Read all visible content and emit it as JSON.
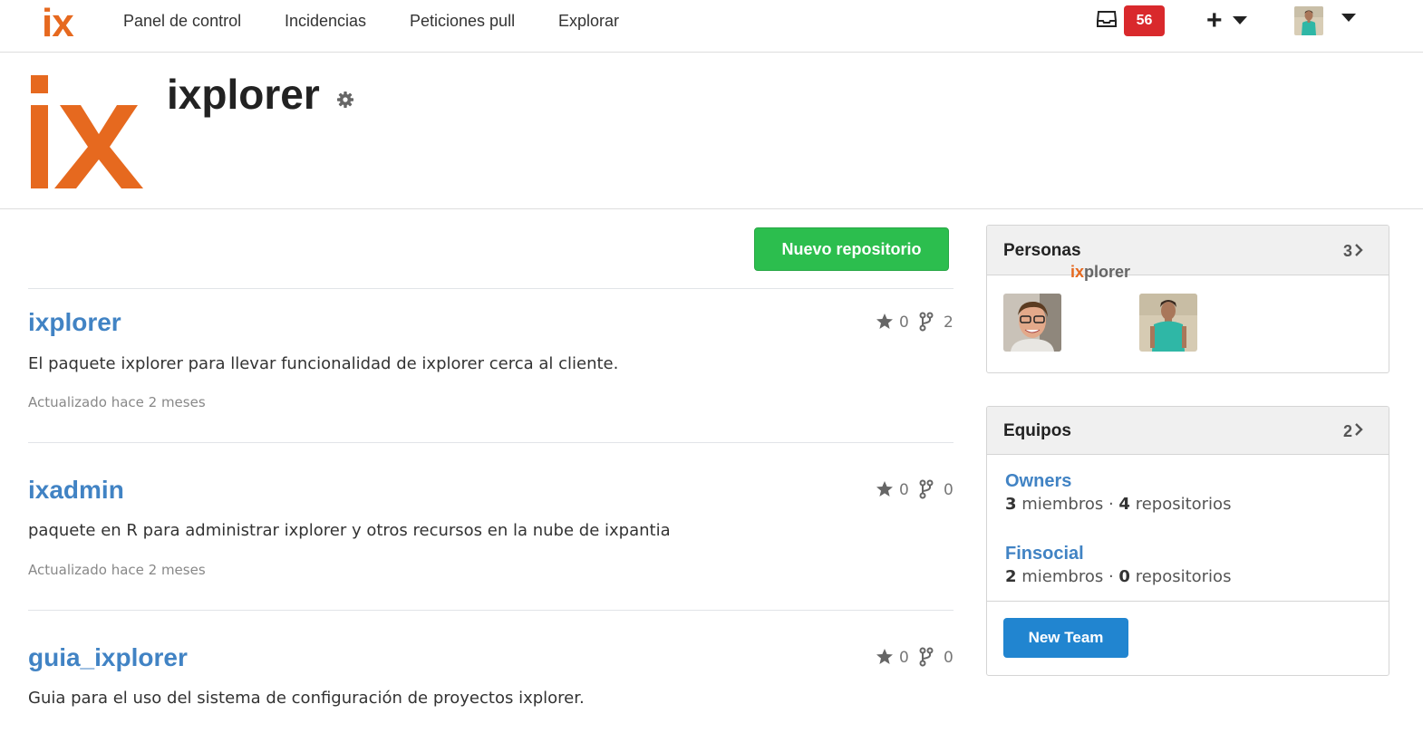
{
  "nav": {
    "logo": "ix",
    "items": [
      "Panel de control",
      "Incidencias",
      "Peticiones pull",
      "Explorar"
    ],
    "notification_count": "56",
    "icons": [
      "inbox-icon",
      "plus-icon",
      "caret-down-icon",
      "avatar"
    ]
  },
  "org": {
    "logo_text": "ix",
    "name": "ixplorer",
    "brand_color": "#e6691f"
  },
  "repos_section": {
    "new_repo_label": "Nuevo repositorio",
    "repos": [
      {
        "name": "ixplorer",
        "description": "El paquete ixplorer para llevar funcionalidad de ixplorer cerca al cliente.",
        "updated": "Actualizado hace 2 meses",
        "stars": "0",
        "forks": "2"
      },
      {
        "name": "ixadmin",
        "description": "paquete en R para administrar ixplorer y otros recursos en la nube de ixpantia",
        "updated": "Actualizado hace 2 meses",
        "stars": "0",
        "forks": "0"
      },
      {
        "name": "guia_ixplorer",
        "description": "Guia para el uso del sistema de configuración de proyectos ixplorer.",
        "updated": "",
        "stars": "0",
        "forks": "0"
      }
    ]
  },
  "people": {
    "title": "Personas",
    "count": "3",
    "org_member_prefix": "ix",
    "org_member_suffix": "plorer"
  },
  "teams": {
    "title": "Equipos",
    "count": "2",
    "list": [
      {
        "name": "Owners",
        "members": "3",
        "members_label": "miembros",
        "repos": "4",
        "repos_label": "repositorios"
      },
      {
        "name": "Finsocial",
        "members": "2",
        "members_label": "miembros",
        "repos": "0",
        "repos_label": "repositorios"
      }
    ],
    "new_team_label": "New Team"
  },
  "colors": {
    "link": "#4183c4",
    "green_button": "#2cbe4e",
    "blue_button": "#2185d0",
    "badge_red": "#d9292c"
  }
}
